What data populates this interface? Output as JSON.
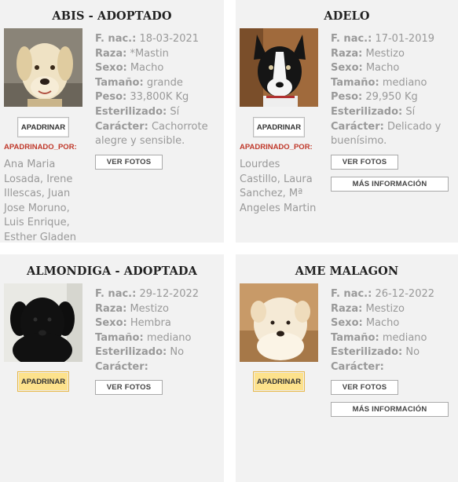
{
  "cards": [
    {
      "title": "ABIS - ADOPTADO",
      "photo_icon": "dog-photo",
      "apadrinar_label": "APADRINAR",
      "apadrinado_por_label": "APADRINADO_POR:",
      "sponsors": "Ana Maria Losada, Irene Illescas, Juan Jose Moruno, Luis Enrique, Esther Gladen",
      "fields": [
        {
          "k": "F. nac.:",
          "v": "18-03-2021"
        },
        {
          "k": "Raza:",
          "v": "*Mastin"
        },
        {
          "k": "Sexo:",
          "v": "Macho"
        },
        {
          "k": "Tamaño:",
          "v": "grande"
        },
        {
          "k": "Peso:",
          "v": "33,800K Kg"
        },
        {
          "k": "Esterilizado:",
          "v": "Sí"
        },
        {
          "k": "Carácter:",
          "v": "Cachorrote alegre y sensible."
        }
      ],
      "ver_fotos_label": "VER FOTOS"
    },
    {
      "title": "ADELO",
      "photo_icon": "dog-photo",
      "apadrinar_label": "APADRINAR",
      "apadrinado_por_label": "APADRINADO_POR:",
      "sponsors": "Lourdes Castillo, Laura Sanchez, Mª Angeles Martin",
      "fields": [
        {
          "k": "F. nac.:",
          "v": "17-01-2019"
        },
        {
          "k": "Raza:",
          "v": "Mestizo"
        },
        {
          "k": "Sexo:",
          "v": "Macho"
        },
        {
          "k": "Tamaño:",
          "v": "mediano"
        },
        {
          "k": "Peso:",
          "v": "29,950 Kg"
        },
        {
          "k": "Esterilizado:",
          "v": "Sí"
        },
        {
          "k": "Carácter:",
          "v": "Delicado y buenísimo."
        }
      ],
      "ver_fotos_label": "VER FOTOS",
      "mas_info_label": "MÁS INFORMACIÓN"
    },
    {
      "title": "ALMONDIGA - ADOPTADA",
      "photo_icon": "dog-photo",
      "apadrinar_label": "APADRINAR",
      "fields": [
        {
          "k": "F. nac.:",
          "v": "29-12-2022"
        },
        {
          "k": "Raza:",
          "v": "Mestizo"
        },
        {
          "k": "Sexo:",
          "v": "Hembra"
        },
        {
          "k": "Tamaño:",
          "v": "mediano"
        },
        {
          "k": "Esterilizado:",
          "v": "No"
        },
        {
          "k": "Carácter:",
          "v": ""
        }
      ],
      "ver_fotos_label": "VER FOTOS"
    },
    {
      "title": "AME MALAGON",
      "photo_icon": "dog-photo",
      "apadrinar_label": "APADRINAR",
      "fields": [
        {
          "k": "F. nac.:",
          "v": "26-12-2022"
        },
        {
          "k": "Raza:",
          "v": "Mestizo"
        },
        {
          "k": "Sexo:",
          "v": "Macho"
        },
        {
          "k": "Tamaño:",
          "v": "mediano"
        },
        {
          "k": "Esterilizado:",
          "v": "No"
        },
        {
          "k": "Carácter:",
          "v": ""
        }
      ],
      "ver_fotos_label": "VER FOTOS",
      "mas_info_label": "MÁS INFORMACIÓN"
    }
  ],
  "colors": {
    "card_bg": "#f2f2f2",
    "title": "#222222",
    "text": "#999999",
    "apadrinado_label": "#c0392b",
    "apadrinar_yellow": "#fde28c"
  }
}
